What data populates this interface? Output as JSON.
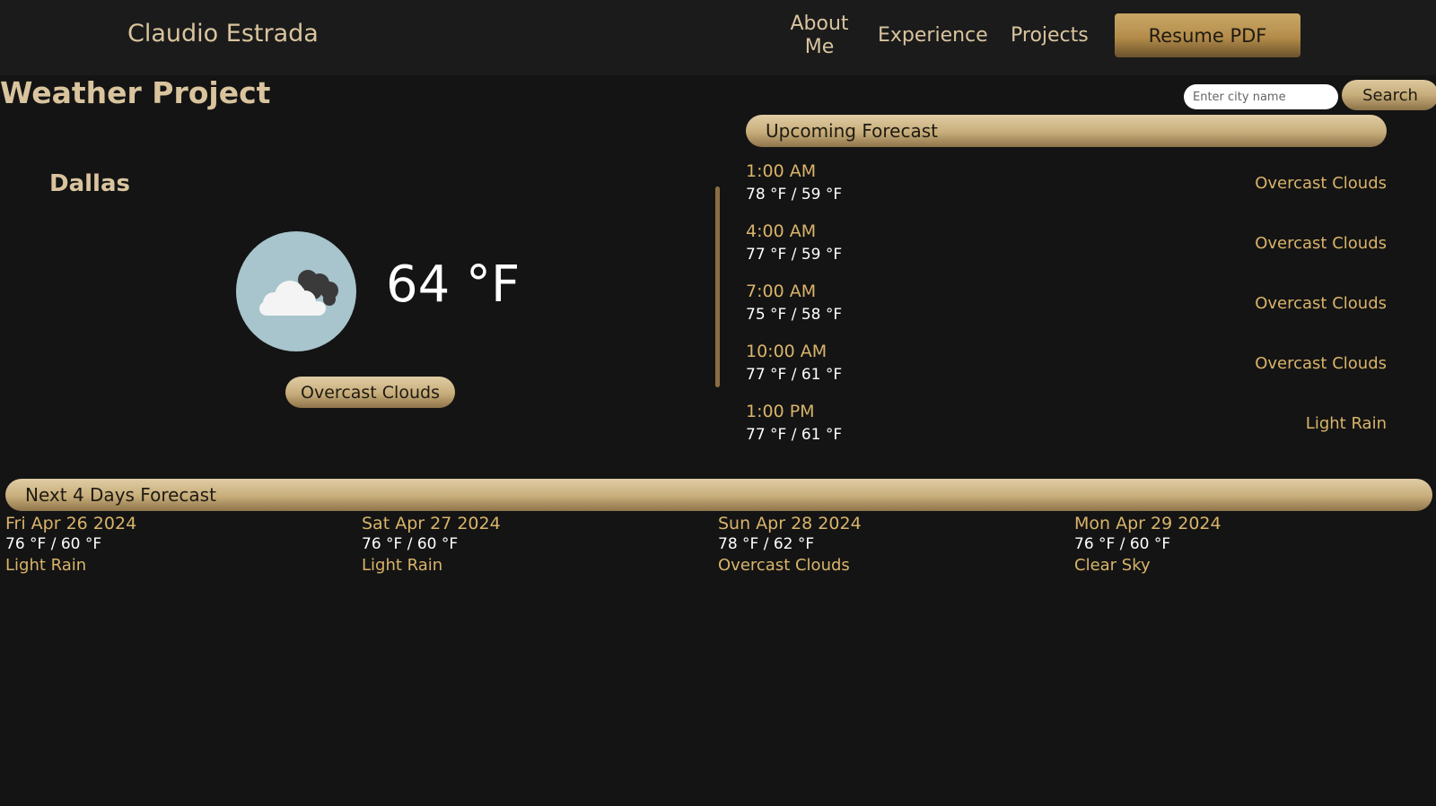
{
  "header": {
    "brand": "Claudio Estrada",
    "nav": {
      "about": "About Me",
      "experience": "Experience",
      "projects": "Projects"
    },
    "resume_label": "Resume PDF"
  },
  "page_title": "Weather Project",
  "search": {
    "placeholder": "Enter city name",
    "button_label": "Search"
  },
  "current": {
    "city": "Dallas",
    "temperature": "64 °F",
    "condition": "Overcast Clouds",
    "icon": "cloud-icon"
  },
  "upcoming": {
    "title": "Upcoming Forecast",
    "items": [
      {
        "time": "1:00 AM",
        "temps": "78 °F / 59 °F",
        "desc": "Overcast Clouds"
      },
      {
        "time": "4:00 AM",
        "temps": "77 °F / 59 °F",
        "desc": "Overcast Clouds"
      },
      {
        "time": "7:00 AM",
        "temps": "75 °F / 58 °F",
        "desc": "Overcast Clouds"
      },
      {
        "time": "10:00 AM",
        "temps": "77 °F / 61 °F",
        "desc": "Overcast Clouds"
      },
      {
        "time": "1:00 PM",
        "temps": "77 °F / 61 °F",
        "desc": "Light Rain"
      }
    ]
  },
  "daily": {
    "title": "Next 4 Days Forecast",
    "days": [
      {
        "date": "Fri Apr 26 2024",
        "temps": "76 °F / 60 °F",
        "desc": "Light Rain"
      },
      {
        "date": "Sat Apr 27 2024",
        "temps": "76 °F / 60 °F",
        "desc": "Light Rain"
      },
      {
        "date": "Sun Apr 28 2024",
        "temps": "78 °F / 62 °F",
        "desc": "Overcast Clouds"
      },
      {
        "date": "Mon Apr 29 2024",
        "temps": "76 °F / 60 °F",
        "desc": "Clear Sky"
      }
    ]
  },
  "colors": {
    "accent_gold": "#d9c49e",
    "accent_text": "#d9b46a",
    "background": "#141414"
  }
}
